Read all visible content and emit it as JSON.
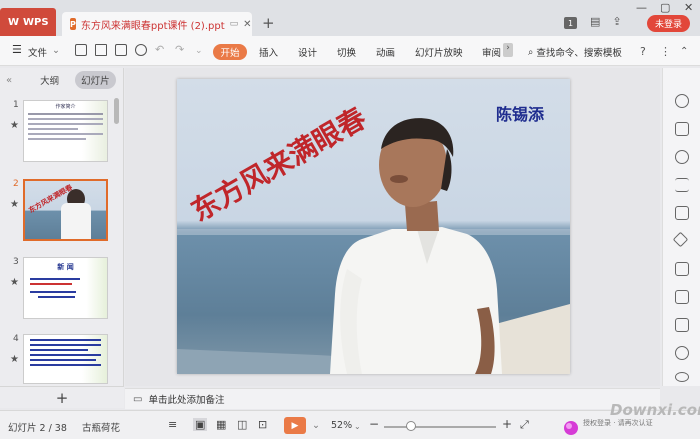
{
  "titlebar": {
    "wps_label": "WPS",
    "doc_tab_title": "东方风来满眼春ppt课件 (2).ppt",
    "new_tab": "+",
    "counter_badge": "1",
    "login_button": "未登录"
  },
  "menubar": {
    "file_menu": "文件",
    "tabs": [
      "开始",
      "插入",
      "设计",
      "切换",
      "动画",
      "幻灯片放映",
      "审阅"
    ],
    "search_label": "查找命令、搜索模板"
  },
  "leftpane": {
    "outline_tab": "大纲",
    "slides_tab": "幻灯片",
    "slide_numbers": [
      "1",
      "2",
      "3",
      "4"
    ],
    "add_slide": "+",
    "thumbnails": {
      "t1_title": "作家简介",
      "t2_title": "东方风来满眼春",
      "t3_title": "新 闻"
    }
  },
  "slide": {
    "title": "东方风来满眼春",
    "author": "陈锡添"
  },
  "notes": {
    "placeholder": "单击此处添加备注"
  },
  "statusbar": {
    "slide_counter": "幻灯片 2 / 38",
    "theme_name": "古瓶荷花",
    "zoom": "52%",
    "zoom_minus": "−",
    "zoom_plus": "+"
  },
  "watermark": {
    "text": "Downxi.com",
    "subtext": "授权登录 · 请再次认证"
  },
  "colors": {
    "accent": "#ea7a47",
    "wps_red": "#d04a3b",
    "title_red": "#c0262a",
    "author_blue": "#1f2d8f"
  }
}
